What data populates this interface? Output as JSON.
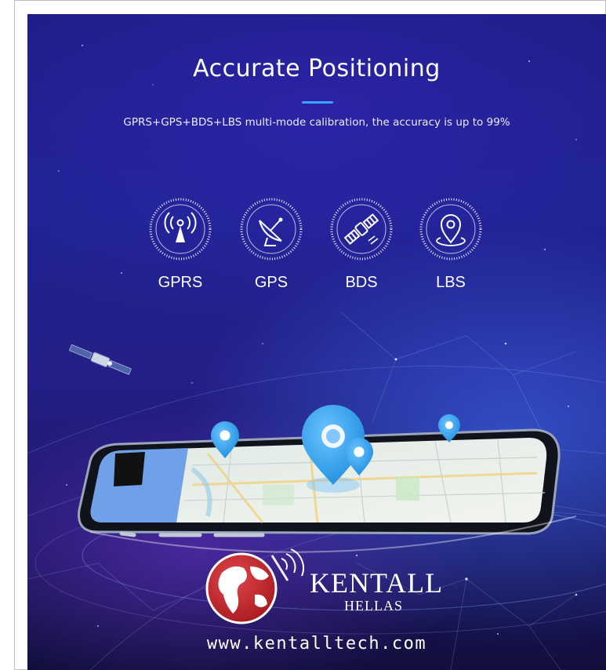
{
  "headline": "Accurate Positioning",
  "subheading": "GPRS+GPS+BDS+LBS multi-mode calibration, the accuracy is up to 99%",
  "modes": [
    {
      "label": "GPRS",
      "icon": "signal-tower-icon"
    },
    {
      "label": "GPS",
      "icon": "satellite-dish-icon"
    },
    {
      "label": "BDS",
      "icon": "satellite-icon"
    },
    {
      "label": "LBS",
      "icon": "location-pin-icon"
    }
  ],
  "brand": {
    "name": "KENTALL",
    "sub": "HELLAS",
    "website": "www.kentalltech.com"
  },
  "colors": {
    "accent": "#3aa4ff",
    "background_top": "#1b1d82",
    "background_bottom": "#120f3e",
    "globe_red": "#c5262b",
    "map_pin": "#3aa4ff"
  }
}
